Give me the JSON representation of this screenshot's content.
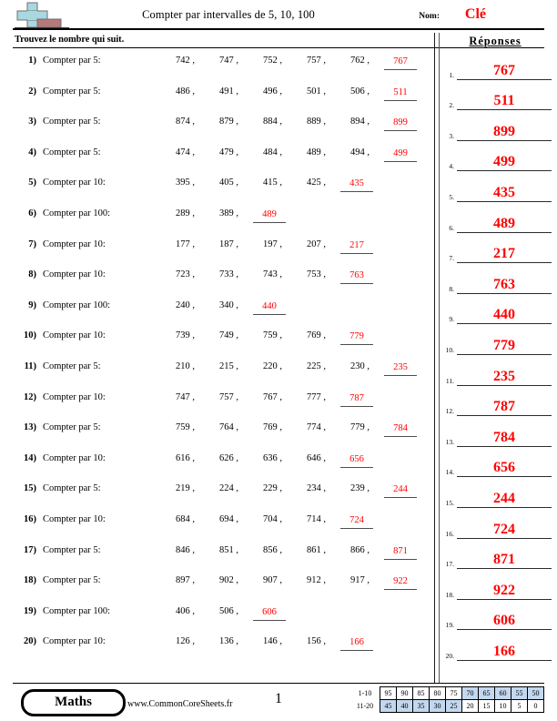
{
  "header": {
    "title": "Compter par intervalles de 5, 10, 100",
    "name_label": "Nom:",
    "name_value": "Clé",
    "icon": "plus-block-icon"
  },
  "instruction": "Trouvez le nombre qui suit.",
  "answers_panel": {
    "title": "Réponses"
  },
  "colors": {
    "answer_red": "#ff0000",
    "score_highlight": "#c3d8ef",
    "icon_plus": "#a8d8e0",
    "icon_block": "#b5797a"
  },
  "problems": [
    {
      "n": "1)",
      "label": "Compter par 5:",
      "terms": [
        "742 ,",
        "747 ,",
        "752 ,",
        "757 ,",
        "762 ,"
      ],
      "answer": "767"
    },
    {
      "n": "2)",
      "label": "Compter par 5:",
      "terms": [
        "486 ,",
        "491 ,",
        "496 ,",
        "501 ,",
        "506 ,"
      ],
      "answer": "511"
    },
    {
      "n": "3)",
      "label": "Compter par 5:",
      "terms": [
        "874 ,",
        "879 ,",
        "884 ,",
        "889 ,",
        "894 ,"
      ],
      "answer": "899"
    },
    {
      "n": "4)",
      "label": "Compter par 5:",
      "terms": [
        "474 ,",
        "479 ,",
        "484 ,",
        "489 ,",
        "494 ,"
      ],
      "answer": "499"
    },
    {
      "n": "5)",
      "label": "Compter par 10:",
      "terms": [
        "395 ,",
        "405 ,",
        "415 ,",
        "425 ,"
      ],
      "answer": "435"
    },
    {
      "n": "6)",
      "label": "Compter par 100:",
      "terms": [
        "289 ,",
        "389 ,"
      ],
      "answer": "489"
    },
    {
      "n": "7)",
      "label": "Compter par 10:",
      "terms": [
        "177 ,",
        "187 ,",
        "197 ,",
        "207 ,"
      ],
      "answer": "217"
    },
    {
      "n": "8)",
      "label": "Compter par 10:",
      "terms": [
        "723 ,",
        "733 ,",
        "743 ,",
        "753 ,"
      ],
      "answer": "763"
    },
    {
      "n": "9)",
      "label": "Compter par 100:",
      "terms": [
        "240 ,",
        "340 ,"
      ],
      "answer": "440"
    },
    {
      "n": "10)",
      "label": "Compter par 10:",
      "terms": [
        "739 ,",
        "749 ,",
        "759 ,",
        "769 ,"
      ],
      "answer": "779"
    },
    {
      "n": "11)",
      "label": "Compter par 5:",
      "terms": [
        "210 ,",
        "215 ,",
        "220 ,",
        "225 ,",
        "230 ,"
      ],
      "answer": "235"
    },
    {
      "n": "12)",
      "label": "Compter par 10:",
      "terms": [
        "747 ,",
        "757 ,",
        "767 ,",
        "777 ,"
      ],
      "answer": "787"
    },
    {
      "n": "13)",
      "label": "Compter par 5:",
      "terms": [
        "759 ,",
        "764 ,",
        "769 ,",
        "774 ,",
        "779 ,"
      ],
      "answer": "784"
    },
    {
      "n": "14)",
      "label": "Compter par 10:",
      "terms": [
        "616 ,",
        "626 ,",
        "636 ,",
        "646 ,"
      ],
      "answer": "656"
    },
    {
      "n": "15)",
      "label": "Compter par 5:",
      "terms": [
        "219 ,",
        "224 ,",
        "229 ,",
        "234 ,",
        "239 ,"
      ],
      "answer": "244"
    },
    {
      "n": "16)",
      "label": "Compter par 10:",
      "terms": [
        "684 ,",
        "694 ,",
        "704 ,",
        "714 ,"
      ],
      "answer": "724"
    },
    {
      "n": "17)",
      "label": "Compter par 5:",
      "terms": [
        "846 ,",
        "851 ,",
        "856 ,",
        "861 ,",
        "866 ,"
      ],
      "answer": "871"
    },
    {
      "n": "18)",
      "label": "Compter par 5:",
      "terms": [
        "897 ,",
        "902 ,",
        "907 ,",
        "912 ,",
        "917 ,"
      ],
      "answer": "922"
    },
    {
      "n": "19)",
      "label": "Compter par 100:",
      "terms": [
        "406 ,",
        "506 ,"
      ],
      "answer": "606"
    },
    {
      "n": "20)",
      "label": "Compter par 10:",
      "terms": [
        "126 ,",
        "136 ,",
        "146 ,",
        "156 ,"
      ],
      "answer": "166"
    }
  ],
  "answer_key": [
    {
      "index": "1.",
      "value": "767"
    },
    {
      "index": "2.",
      "value": "511"
    },
    {
      "index": "3.",
      "value": "899"
    },
    {
      "index": "4.",
      "value": "499"
    },
    {
      "index": "5.",
      "value": "435"
    },
    {
      "index": "6.",
      "value": "489"
    },
    {
      "index": "7.",
      "value": "217"
    },
    {
      "index": "8.",
      "value": "763"
    },
    {
      "index": "9.",
      "value": "440"
    },
    {
      "index": "10.",
      "value": "779"
    },
    {
      "index": "11.",
      "value": "235"
    },
    {
      "index": "12.",
      "value": "787"
    },
    {
      "index": "13.",
      "value": "784"
    },
    {
      "index": "14.",
      "value": "656"
    },
    {
      "index": "15.",
      "value": "244"
    },
    {
      "index": "16.",
      "value": "724"
    },
    {
      "index": "17.",
      "value": "871"
    },
    {
      "index": "18.",
      "value": "922"
    },
    {
      "index": "19.",
      "value": "606"
    },
    {
      "index": "20.",
      "value": "166"
    }
  ],
  "footer": {
    "brand": "Maths",
    "url": "www.CommonCoreSheets.fr",
    "page_number": "1",
    "score_table": {
      "row1_label": "1-10",
      "row2_label": "11-20",
      "row1": [
        {
          "v": "95",
          "hl": false
        },
        {
          "v": "90",
          "hl": false
        },
        {
          "v": "85",
          "hl": false
        },
        {
          "v": "80",
          "hl": false
        },
        {
          "v": "75",
          "hl": false
        },
        {
          "v": "70",
          "hl": true
        },
        {
          "v": "65",
          "hl": true
        },
        {
          "v": "60",
          "hl": true
        },
        {
          "v": "55",
          "hl": true
        },
        {
          "v": "50",
          "hl": true
        }
      ],
      "row2": [
        {
          "v": "45",
          "hl": true
        },
        {
          "v": "40",
          "hl": true
        },
        {
          "v": "35",
          "hl": true
        },
        {
          "v": "30",
          "hl": true
        },
        {
          "v": "25",
          "hl": true
        },
        {
          "v": "20",
          "hl": false
        },
        {
          "v": "15",
          "hl": false
        },
        {
          "v": "10",
          "hl": false
        },
        {
          "v": "5",
          "hl": false
        },
        {
          "v": "0",
          "hl": false
        }
      ]
    }
  }
}
